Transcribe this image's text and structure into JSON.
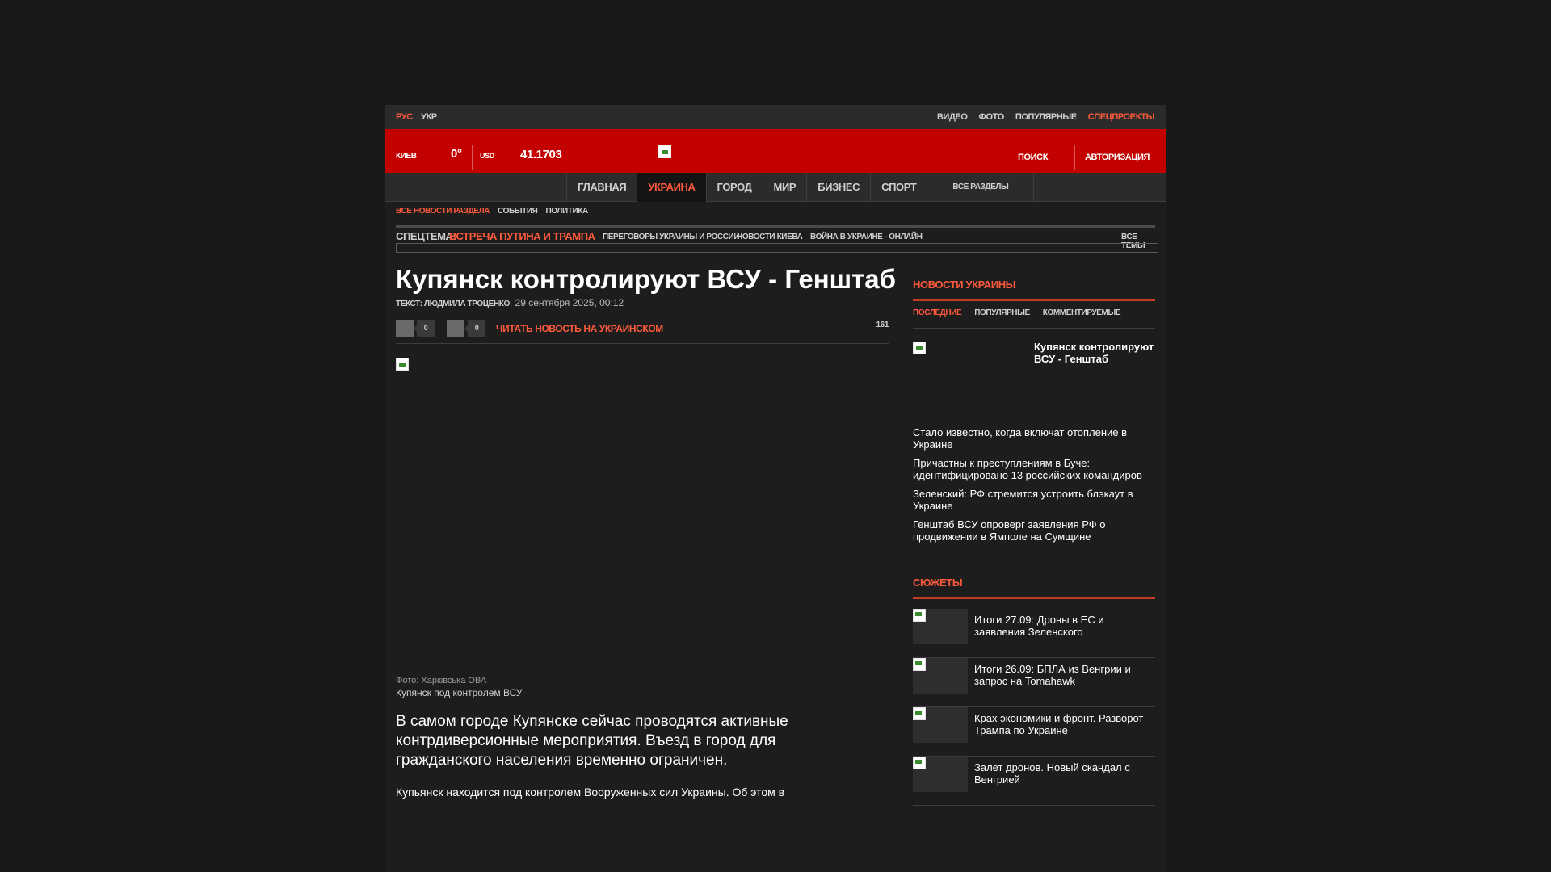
{
  "topbar": {
    "lang_ru": "РУС",
    "lang_ua": "УКР",
    "links": [
      {
        "label": "ВИДЕО",
        "accent": false
      },
      {
        "label": "ФОТО",
        "accent": false
      },
      {
        "label": "ПОПУЛЯРНЫЕ",
        "accent": false
      },
      {
        "label": "СПЕЦПРОЕКТЫ",
        "accent": true
      }
    ]
  },
  "header": {
    "city": "КИЕВ",
    "temperature": "0°",
    "currency": "USD",
    "rate": "41.1703",
    "search": "ПОИСК",
    "auth": "АВТОРИЗАЦИЯ"
  },
  "nav": {
    "items": [
      "ГЛАВНАЯ",
      "УКРАИНА",
      "ГОРОД",
      "МИР",
      "БИЗНЕС",
      "СПОРТ"
    ],
    "active": "УКРАИНА",
    "all": "ВСЕ РАЗДЕЛЫ"
  },
  "subnav": [
    "ВСЕ НОВОСТИ РАЗДЕЛА",
    "СОБЫТИЯ",
    "ПОЛИТИКА"
  ],
  "topics": {
    "label": "СПЕЦТЕМА:",
    "hot": "ВСТРЕЧА ПУТИНА И ТРАМПА",
    "items": [
      "ПЕРЕГОВОРЫ УКРАИНЫ И РОССИИ",
      "НОВОСТИ КИЕВА",
      "ВОЙНА В УКРАИНЕ - ОНЛАЙН"
    ],
    "all": "ВСЕ ТЕМЫ"
  },
  "article": {
    "title": "Купянск контролируют ВСУ - Генштаб",
    "byline_prefix": "ТЕКСТ: ЛЮДМИЛА ТРОЦЕНКО",
    "date": "29 сентября 2025, 00:12",
    "share_count_1": "0",
    "share_count_2": "0",
    "read_ua": "ЧИТАТЬ НОВОСТЬ НА УКРАИНСКОМ",
    "views": "161",
    "photo_credit": "Фото: Харківська ОВА",
    "image_caption": "Купянск под контролем ВСУ",
    "lead": "В самом городе Купянске сейчас проводятся активные контрдиверсионные мероприятия. Въезд в город для гражданского населения временно ограничен.",
    "paragraph": "Купьянск находится под контролем Вооруженных сил Украины. Об этом в"
  },
  "sidebar": {
    "news_title": "НОВОСТИ УКРАИНЫ",
    "tabs": [
      "ПОСЛЕДНИЕ",
      "ПОПУЛЯРНЫЕ",
      "КОММЕНТИРУЕМЫЕ"
    ],
    "featured": "Купянск контролируют ВСУ - Генштаб",
    "news": [
      "Стало известно, когда включат отопление в Украине",
      "Причастны к преступлениям в Буче: идентифицировано 13 российских командиров",
      "Зеленский: РФ стремится устроить блэкаут в Украине",
      "Генштаб ВСУ опроверг заявления РФ о продвижении в Ямполе на Сумщине"
    ],
    "stories_title": "СЮЖЕТЫ",
    "stories": [
      "Итоги 27.09: Дроны в ЕС и заявления Зеленского",
      "Итоги 26.09: БПЛА из Венгрии и запрос на Tomahawk",
      "Крах экономики и фронт. Разворот Трампа по Украине",
      "Залет дронов. Новый скандал с Венгрией"
    ]
  },
  "colors": {
    "accent": "#ff5a3c",
    "header_red": "#c40101",
    "background": "#191919"
  }
}
